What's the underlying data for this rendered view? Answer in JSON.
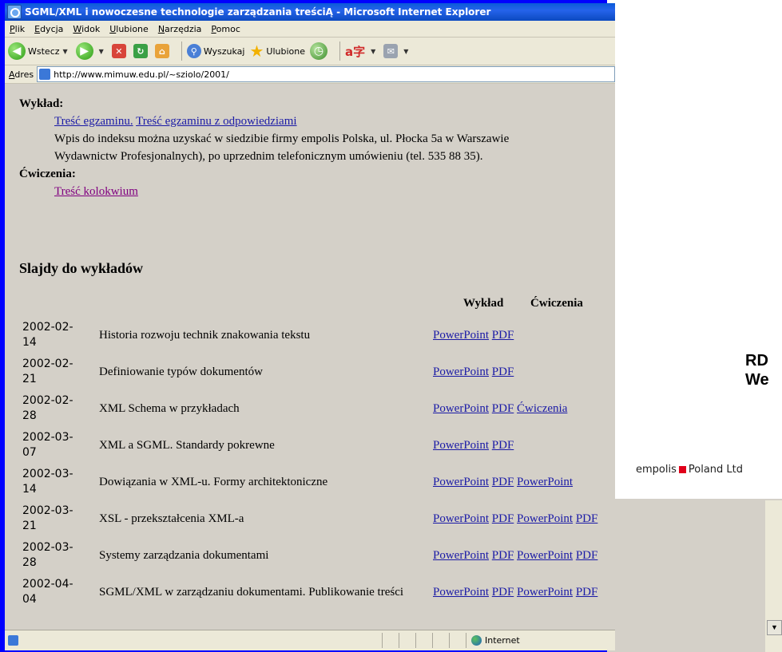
{
  "window": {
    "title": "SGML/XML i nowoczesne technologie zarządzania treściĄ - Microsoft Internet Explorer"
  },
  "menu": [
    "Plik",
    "Edycja",
    "Widok",
    "Ulubione",
    "Narzędzia",
    "Pomoc"
  ],
  "toolbar": {
    "back": "Wstecz",
    "search": "Wyszukaj",
    "favorites": "Ulubione"
  },
  "address": {
    "label": "Adres",
    "url": "http://www.mimuw.edu.pl/~sziolo/2001/"
  },
  "content": {
    "lecture_heading": "Wykład:",
    "exam_link": "Treść egzaminu.",
    "exam_answers_link": "Treść egzaminu z odpowiedziami",
    "enrollment_line1": "Wpis do indeksu można uzyskać w siedzibie firmy empolis Polska, ul. Płocka 5a w Warszawie",
    "enrollment_line2": "Wydawnictw Profesjonalnych), po uprzednim telefonicznym umówieniu (tel. 535 88 35).",
    "exercises_heading": "Ćwiczenia:",
    "colloquium_link": "Treść kolokwium",
    "slides_heading": "Slajdy do wykładów",
    "col_lecture": "Wykład",
    "col_exercises": "Ćwiczenia",
    "rows": [
      {
        "date": "2002-02-14",
        "topic": "Historia rozwoju technik znakowania tekstu",
        "links": [
          "PowerPoint",
          "PDF"
        ]
      },
      {
        "date": "2002-02-21",
        "topic": "Definiowanie typów dokumentów",
        "links": [
          "PowerPoint",
          "PDF"
        ]
      },
      {
        "date": "2002-02-28",
        "topic": "XML Schema w przykładach",
        "links": [
          "PowerPoint",
          "PDF",
          "Ćwiczenia"
        ]
      },
      {
        "date": "2002-03-07",
        "topic": "XML a SGML. Standardy pokrewne",
        "links": [
          "PowerPoint",
          "PDF"
        ]
      },
      {
        "date": "2002-03-14",
        "topic": "Dowiązania w XML-u. Formy architektoniczne",
        "links": [
          "PowerPoint",
          "PDF",
          "PowerPoint"
        ]
      },
      {
        "date": "2002-03-21",
        "topic": "XSL - przekształcenia XML-a",
        "links": [
          "PowerPoint",
          "PDF",
          "PowerPoint",
          "PDF"
        ]
      },
      {
        "date": "2002-03-28",
        "topic": "Systemy zarządzania dokumentami",
        "links": [
          "PowerPoint",
          "PDF",
          "PowerPoint",
          "PDF"
        ]
      },
      {
        "date": "2002-04-04",
        "topic": "SGML/XML w zarządzaniu dokumentami. Publikowanie treści",
        "links": [
          "PowerPoint",
          "PDF",
          "PowerPoint",
          "PDF"
        ]
      }
    ]
  },
  "status": {
    "zone": "Internet"
  },
  "slide": {
    "title_partial": "RD\nWe",
    "brand_left": "empolis",
    "brand_right": "Poland Ltd"
  },
  "colors": {
    "slide_background": "#0000ff",
    "link": "#1a1aa6",
    "visited_link": "#800080",
    "brand_square": "#e0001a"
  }
}
